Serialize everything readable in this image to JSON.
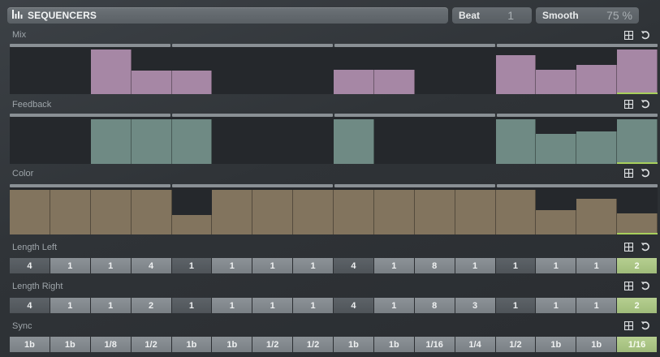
{
  "header": {
    "title": "SEQUENCERS",
    "beat_label": "Beat",
    "beat_value": "1",
    "smooth_label": "Smooth",
    "smooth_value": "75 %"
  },
  "icons": {
    "title": "bars-icon",
    "grid": "grid-icon",
    "reset": "reset-icon"
  },
  "colors": {
    "mix_bar": "#a687a5",
    "feedback_bar": "#6f8a84",
    "color_bar": "#82745e",
    "active_step": "#a8cf5c",
    "lite_cell": "#858b90",
    "dark_cell": "#555a5f"
  },
  "steps": 16,
  "active_step": 16,
  "sequencers": {
    "mix": {
      "label": "Mix",
      "levels": [
        0,
        0,
        1.0,
        0.53,
        0.53,
        0,
        0,
        0,
        0.55,
        0.55,
        0,
        0,
        0.88,
        0.55,
        0.65,
        1.0
      ]
    },
    "feedback": {
      "label": "Feedback",
      "levels": [
        0,
        0,
        1.0,
        1.0,
        1.0,
        0,
        0,
        0,
        1.0,
        0,
        0,
        0,
        1.0,
        0.67,
        0.73,
        1.0
      ]
    },
    "color": {
      "label": "Color",
      "levels": [
        1.0,
        1.0,
        1.0,
        1.0,
        0.43,
        1.0,
        1.0,
        1.0,
        1.0,
        1.0,
        1.0,
        1.0,
        1.0,
        0.55,
        0.8,
        0.47
      ]
    },
    "length_left": {
      "label": "Length Left",
      "values": [
        "4",
        "1",
        "1",
        "4",
        "1",
        "1",
        "1",
        "1",
        "4",
        "1",
        "8",
        "1",
        "1",
        "1",
        "1",
        "2"
      ]
    },
    "length_right": {
      "label": "Length Right",
      "values": [
        "4",
        "1",
        "1",
        "2",
        "1",
        "1",
        "1",
        "1",
        "4",
        "1",
        "8",
        "3",
        "1",
        "1",
        "1",
        "2"
      ]
    },
    "sync": {
      "label": "Sync",
      "values": [
        "1b",
        "1b",
        "1/8",
        "1/2",
        "1b",
        "1b",
        "1/2",
        "1/2",
        "1b",
        "1b",
        "1/16",
        "1/4",
        "1/2",
        "1b",
        "1b",
        "1/16"
      ]
    }
  }
}
